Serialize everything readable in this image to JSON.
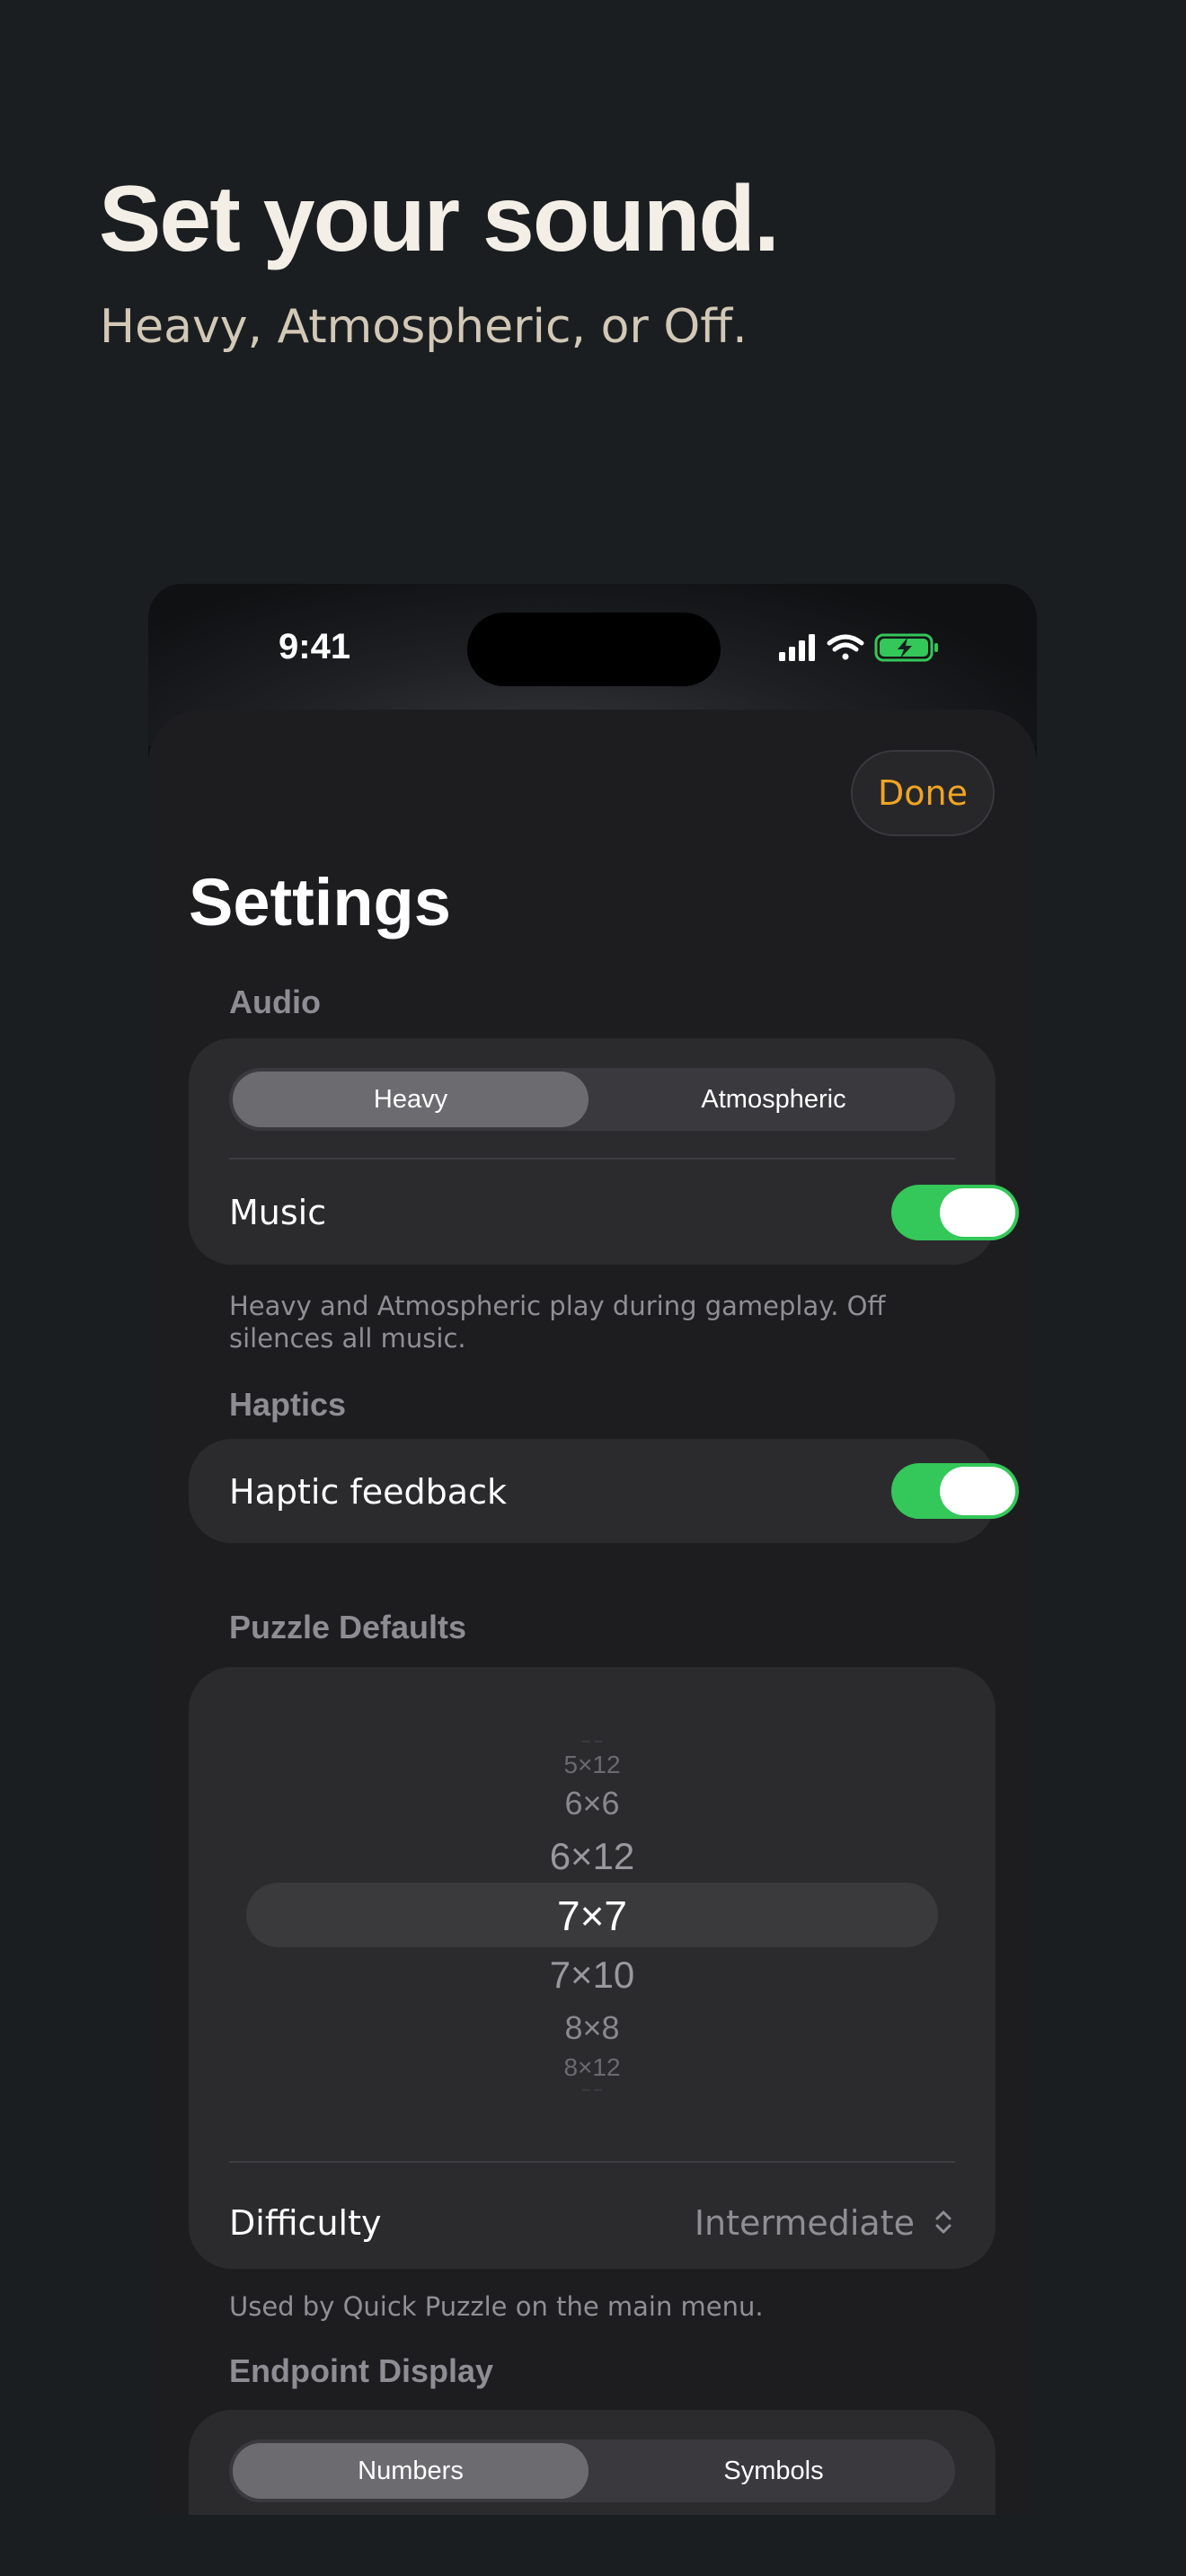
{
  "headline": "Set your sound.",
  "subheadline": "Heavy, Atmospheric, or Off.",
  "status_bar": {
    "time": "9:41",
    "icons": [
      "cellular-signal-icon",
      "wifi-icon",
      "battery-charging-icon"
    ],
    "battery_color": "#34c759"
  },
  "settings": {
    "done_label": "Done",
    "title": "Settings",
    "accent_color": "#f0a423",
    "audio": {
      "header": "Audio",
      "segments": [
        "Heavy",
        "Atmospheric"
      ],
      "selected": "Heavy",
      "music_label": "Music",
      "music_on": true,
      "footnote": "Heavy and Atmospheric play during gameplay. Off silences all music."
    },
    "haptics": {
      "header": "Haptics",
      "feedback_label": "Haptic feedback",
      "feedback_on": true
    },
    "puzzle_defaults": {
      "header": "Puzzle Defaults",
      "size_options": [
        "5×12",
        "6×6",
        "6×12",
        "7×7",
        "7×10",
        "8×8",
        "8×12"
      ],
      "selected_size": "7×7",
      "difficulty_label": "Difficulty",
      "difficulty_value": "Intermediate",
      "footnote": "Used by Quick Puzzle on the main menu."
    },
    "endpoint_display": {
      "header": "Endpoint Display",
      "segments": [
        "Numbers",
        "Symbols"
      ],
      "selected": "Numbers"
    }
  },
  "toggle_color": "#34c759"
}
